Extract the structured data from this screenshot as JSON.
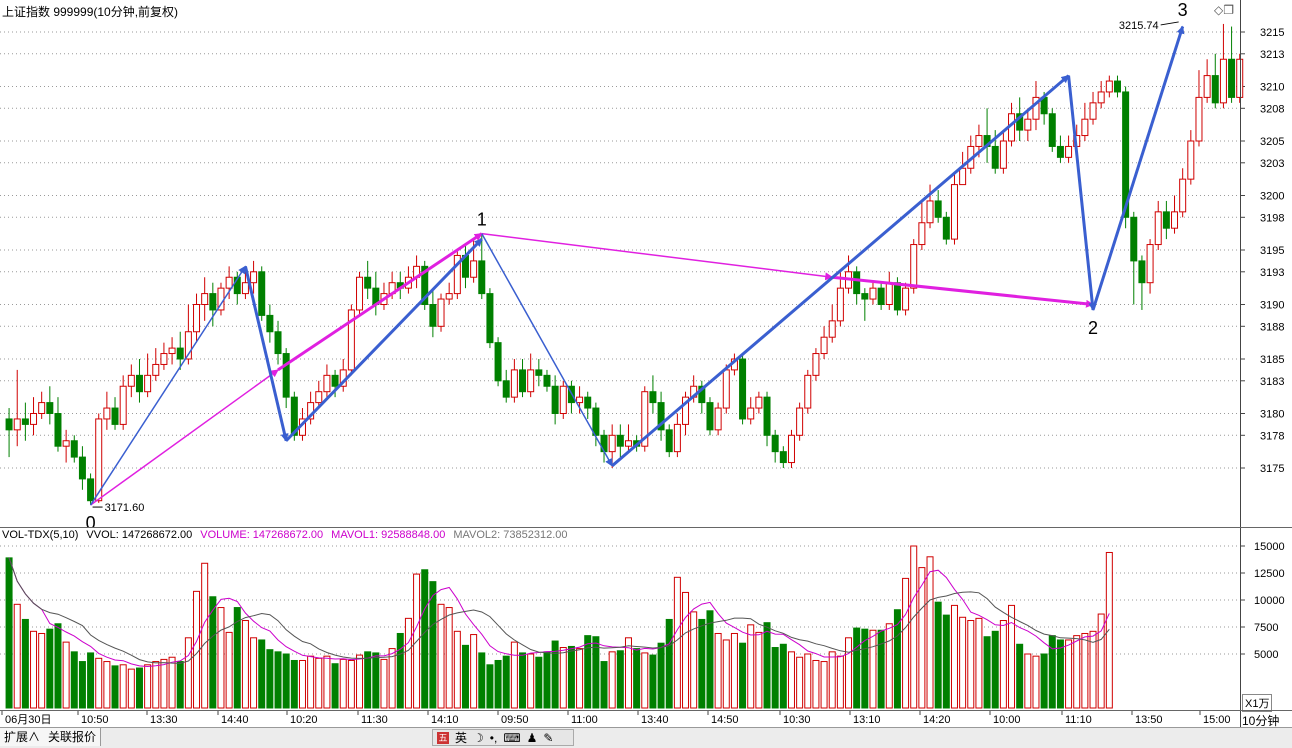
{
  "header": {
    "title": "上证指数 999999(10分钟,前复权)"
  },
  "volume_header": {
    "indicator": "VOL-TDX(5,10)",
    "vvol": "VVOL: 147268672.00",
    "volume": "VOLUME: 147268672.00",
    "mavol1": "MAVOL1: 92588848.00",
    "mavol2": "MAVOL2: 73852312.00"
  },
  "price_axis": [
    "3215",
    "3213",
    "3210",
    "3208",
    "3205",
    "3203",
    "3200",
    "3198",
    "3195",
    "3193",
    "3190",
    "3188",
    "3185",
    "3183",
    "3180",
    "3178",
    "3175"
  ],
  "volume_axis": [
    "15000",
    "12500",
    "10000",
    "7500",
    "5000"
  ],
  "volume_unit": "X1万",
  "time_axis": [
    "06月30日",
    "10:50",
    "13:30",
    "14:40",
    "10:20",
    "11:30",
    "14:10",
    "09:50",
    "11:00",
    "13:40",
    "14:50",
    "10:30",
    "13:10",
    "14:20",
    "10:00",
    "11:10",
    "13:50",
    "15:00"
  ],
  "period_label": "10分钟",
  "annotations": {
    "low_value": "3171.60",
    "high_value": "3215.74",
    "wave_labels": [
      "0",
      "1",
      "2",
      "3"
    ]
  },
  "bottom_tabs": {
    "expand": "扩展∧",
    "quotes": "关联报价"
  },
  "ime": {
    "lang": "英"
  },
  "colors": {
    "up": "#d00000",
    "down": "#008000",
    "blue_arrow": "#3a5fd0",
    "magenta_arrow": "#e020e0",
    "ma1": "#cc00cc",
    "ma2": "#555555"
  },
  "chart_data": {
    "type": "candlestick",
    "ylim": [
      3169.5,
      3216.5
    ],
    "candles": [
      {
        "o": 3179.5,
        "c": 3178.5,
        "h": 3180.5,
        "l": 3176
      },
      {
        "o": 3178.5,
        "c": 3179.5,
        "h": 3184,
        "l": 3177
      },
      {
        "o": 3179.5,
        "c": 3179,
        "h": 3181,
        "l": 3177.5
      },
      {
        "o": 3179,
        "c": 3180,
        "h": 3181.5,
        "l": 3178
      },
      {
        "o": 3180,
        "c": 3181,
        "h": 3182,
        "l": 3179.5
      },
      {
        "o": 3181,
        "c": 3180,
        "h": 3182.5,
        "l": 3179
      },
      {
        "o": 3180,
        "c": 3177,
        "h": 3181.5,
        "l": 3176.5
      },
      {
        "o": 3177,
        "c": 3177.5,
        "h": 3178.5,
        "l": 3175.5
      },
      {
        "o": 3177.5,
        "c": 3176,
        "h": 3178,
        "l": 3175.5
      },
      {
        "o": 3176,
        "c": 3174,
        "h": 3177,
        "l": 3173
      },
      {
        "o": 3174,
        "c": 3172,
        "h": 3174.5,
        "l": 3171.6
      },
      {
        "o": 3172,
        "c": 3179.5,
        "h": 3180,
        "l": 3171.8
      },
      {
        "o": 3179.5,
        "c": 3180.5,
        "h": 3182,
        "l": 3178.5
      },
      {
        "o": 3180.5,
        "c": 3179,
        "h": 3181.5,
        "l": 3178.5
      },
      {
        "o": 3179,
        "c": 3182.5,
        "h": 3183.5,
        "l": 3178.5
      },
      {
        "o": 3182.5,
        "c": 3183.5,
        "h": 3184.5,
        "l": 3181.5
      },
      {
        "o": 3183.5,
        "c": 3182,
        "h": 3185,
        "l": 3181
      },
      {
        "o": 3182,
        "c": 3183.5,
        "h": 3185.5,
        "l": 3181.5
      },
      {
        "o": 3183.5,
        "c": 3184.5,
        "h": 3186,
        "l": 3183
      },
      {
        "o": 3184.5,
        "c": 3185.5,
        "h": 3186.5,
        "l": 3184
      },
      {
        "o": 3185.5,
        "c": 3186,
        "h": 3187,
        "l": 3184.5
      },
      {
        "o": 3186,
        "c": 3185,
        "h": 3187.5,
        "l": 3184
      },
      {
        "o": 3185,
        "c": 3187.5,
        "h": 3190,
        "l": 3184.5
      },
      {
        "o": 3187.5,
        "c": 3190,
        "h": 3191,
        "l": 3186.5
      },
      {
        "o": 3190,
        "c": 3191,
        "h": 3192.5,
        "l": 3188.5
      },
      {
        "o": 3191,
        "c": 3189.5,
        "h": 3192,
        "l": 3188
      },
      {
        "o": 3189.5,
        "c": 3191.5,
        "h": 3192,
        "l": 3189
      },
      {
        "o": 3191.5,
        "c": 3192.5,
        "h": 3193.5,
        "l": 3190.5
      },
      {
        "o": 3192.5,
        "c": 3191,
        "h": 3193,
        "l": 3190
      },
      {
        "o": 3191,
        "c": 3192,
        "h": 3193,
        "l": 3190.5
      },
      {
        "o": 3192,
        "c": 3193,
        "h": 3194,
        "l": 3191
      },
      {
        "o": 3193,
        "c": 3189,
        "h": 3193.5,
        "l": 3188.5
      },
      {
        "o": 3189,
        "c": 3187.5,
        "h": 3190,
        "l": 3186.5
      },
      {
        "o": 3187.5,
        "c": 3185.5,
        "h": 3188.5,
        "l": 3184.5
      },
      {
        "o": 3185.5,
        "c": 3181.5,
        "h": 3186,
        "l": 3180.5
      },
      {
        "o": 3181.5,
        "c": 3178,
        "h": 3182,
        "l": 3177.5
      },
      {
        "o": 3178,
        "c": 3179.5,
        "h": 3180.5,
        "l": 3177.5
      },
      {
        "o": 3179.5,
        "c": 3181,
        "h": 3182,
        "l": 3179
      },
      {
        "o": 3181,
        "c": 3182,
        "h": 3183,
        "l": 3180.5
      },
      {
        "o": 3182,
        "c": 3183.5,
        "h": 3184.5,
        "l": 3181.5
      },
      {
        "o": 3183.5,
        "c": 3182.5,
        "h": 3184,
        "l": 3181.5
      },
      {
        "o": 3182.5,
        "c": 3184,
        "h": 3185,
        "l": 3182
      },
      {
        "o": 3184,
        "c": 3189.5,
        "h": 3190,
        "l": 3183.5
      },
      {
        "o": 3189.5,
        "c": 3192.5,
        "h": 3193,
        "l": 3189
      },
      {
        "o": 3192.5,
        "c": 3191.5,
        "h": 3194,
        "l": 3190.5
      },
      {
        "o": 3191.5,
        "c": 3190,
        "h": 3193,
        "l": 3189
      },
      {
        "o": 3190,
        "c": 3191,
        "h": 3192,
        "l": 3189.5
      },
      {
        "o": 3191,
        "c": 3192,
        "h": 3193,
        "l": 3190.5
      },
      {
        "o": 3192,
        "c": 3191.5,
        "h": 3193,
        "l": 3190.5
      },
      {
        "o": 3191.5,
        "c": 3192.5,
        "h": 3193.5,
        "l": 3191
      },
      {
        "o": 3192.5,
        "c": 3193.5,
        "h": 3194.5,
        "l": 3191.5
      },
      {
        "o": 3193.5,
        "c": 3190,
        "h": 3194,
        "l": 3189.5
      },
      {
        "o": 3190,
        "c": 3188,
        "h": 3191.5,
        "l": 3187
      },
      {
        "o": 3188,
        "c": 3190.5,
        "h": 3191,
        "l": 3187.5
      },
      {
        "o": 3190.5,
        "c": 3191,
        "h": 3192,
        "l": 3190
      },
      {
        "o": 3191,
        "c": 3194.5,
        "h": 3195,
        "l": 3190.5
      },
      {
        "o": 3194.5,
        "c": 3192.5,
        "h": 3195.5,
        "l": 3191.5
      },
      {
        "o": 3192.5,
        "c": 3194,
        "h": 3196,
        "l": 3192
      },
      {
        "o": 3194,
        "c": 3191,
        "h": 3196.5,
        "l": 3190.5
      },
      {
        "o": 3191,
        "c": 3186.5,
        "h": 3191.5,
        "l": 3186
      },
      {
        "o": 3186.5,
        "c": 3183,
        "h": 3187,
        "l": 3182.5
      },
      {
        "o": 3183,
        "c": 3181.5,
        "h": 3184,
        "l": 3181
      },
      {
        "o": 3181.5,
        "c": 3184,
        "h": 3185,
        "l": 3181
      },
      {
        "o": 3184,
        "c": 3182,
        "h": 3185,
        "l": 3181.5
      },
      {
        "o": 3182,
        "c": 3184,
        "h": 3185.5,
        "l": 3181.5
      },
      {
        "o": 3184,
        "c": 3183.5,
        "h": 3185,
        "l": 3182.5
      },
      {
        "o": 3183.5,
        "c": 3182.5,
        "h": 3184,
        "l": 3182
      },
      {
        "o": 3182.5,
        "c": 3180,
        "h": 3183.5,
        "l": 3179
      },
      {
        "o": 3180,
        "c": 3182.5,
        "h": 3183,
        "l": 3179.5
      },
      {
        "o": 3182.5,
        "c": 3181,
        "h": 3183,
        "l": 3180
      },
      {
        "o": 3181,
        "c": 3181.5,
        "h": 3182.5,
        "l": 3180
      },
      {
        "o": 3181.5,
        "c": 3180.5,
        "h": 3182,
        "l": 3179.5
      },
      {
        "o": 3180.5,
        "c": 3178,
        "h": 3181,
        "l": 3177
      },
      {
        "o": 3178,
        "c": 3176.5,
        "h": 3178.5,
        "l": 3175.5
      },
      {
        "o": 3176.5,
        "c": 3178,
        "h": 3179,
        "l": 3175
      },
      {
        "o": 3178,
        "c": 3177,
        "h": 3179,
        "l": 3176
      },
      {
        "o": 3177,
        "c": 3177.5,
        "h": 3179,
        "l": 3176.5
      },
      {
        "o": 3177.5,
        "c": 3177,
        "h": 3178,
        "l": 3176.5
      },
      {
        "o": 3177,
        "c": 3182,
        "h": 3182.5,
        "l": 3176.5
      },
      {
        "o": 3182,
        "c": 3181,
        "h": 3183.5,
        "l": 3180
      },
      {
        "o": 3181,
        "c": 3178.5,
        "h": 3182,
        "l": 3177.5
      },
      {
        "o": 3178.5,
        "c": 3176.5,
        "h": 3179,
        "l": 3176
      },
      {
        "o": 3176.5,
        "c": 3179,
        "h": 3180,
        "l": 3176
      },
      {
        "o": 3179,
        "c": 3181.5,
        "h": 3182,
        "l": 3178
      },
      {
        "o": 3181.5,
        "c": 3182.5,
        "h": 3183.5,
        "l": 3181
      },
      {
        "o": 3182.5,
        "c": 3181,
        "h": 3183,
        "l": 3180
      },
      {
        "o": 3181,
        "c": 3178.5,
        "h": 3181.5,
        "l": 3178
      },
      {
        "o": 3178.5,
        "c": 3180.5,
        "h": 3181,
        "l": 3178
      },
      {
        "o": 3180.5,
        "c": 3184,
        "h": 3184.5,
        "l": 3180
      },
      {
        "o": 3184,
        "c": 3185,
        "h": 3185.5,
        "l": 3183.5
      },
      {
        "o": 3185,
        "c": 3179.5,
        "h": 3185.5,
        "l": 3179
      },
      {
        "o": 3179.5,
        "c": 3180.5,
        "h": 3181.5,
        "l": 3179
      },
      {
        "o": 3180.5,
        "c": 3181.5,
        "h": 3182,
        "l": 3180
      },
      {
        "o": 3181.5,
        "c": 3178,
        "h": 3182,
        "l": 3177
      },
      {
        "o": 3178,
        "c": 3176.5,
        "h": 3178.5,
        "l": 3175.5
      },
      {
        "o": 3176.5,
        "c": 3175.5,
        "h": 3177,
        "l": 3175
      },
      {
        "o": 3175.5,
        "c": 3178,
        "h": 3178.5,
        "l": 3175
      },
      {
        "o": 3178,
        "c": 3180.5,
        "h": 3181,
        "l": 3177.5
      },
      {
        "o": 3180.5,
        "c": 3183.5,
        "h": 3184,
        "l": 3180
      },
      {
        "o": 3183.5,
        "c": 3185.5,
        "h": 3186,
        "l": 3183
      },
      {
        "o": 3185.5,
        "c": 3187,
        "h": 3188,
        "l": 3185
      },
      {
        "o": 3187,
        "c": 3188.5,
        "h": 3190,
        "l": 3186.5
      },
      {
        "o": 3188.5,
        "c": 3191.5,
        "h": 3193,
        "l": 3188
      },
      {
        "o": 3191.5,
        "c": 3193,
        "h": 3194.5,
        "l": 3191
      },
      {
        "o": 3193,
        "c": 3191,
        "h": 3193.5,
        "l": 3190
      },
      {
        "o": 3191,
        "c": 3190.5,
        "h": 3191.5,
        "l": 3188.5
      },
      {
        "o": 3190.5,
        "c": 3191.5,
        "h": 3192,
        "l": 3190
      },
      {
        "o": 3191.5,
        "c": 3190,
        "h": 3192,
        "l": 3189.5
      },
      {
        "o": 3190,
        "c": 3192,
        "h": 3193,
        "l": 3189.5
      },
      {
        "o": 3192,
        "c": 3189.5,
        "h": 3192.5,
        "l": 3189
      },
      {
        "o": 3189.5,
        "c": 3191.5,
        "h": 3192,
        "l": 3189
      },
      {
        "o": 3191.5,
        "c": 3195.5,
        "h": 3196,
        "l": 3191
      },
      {
        "o": 3195.5,
        "c": 3197.5,
        "h": 3199.5,
        "l": 3195
      },
      {
        "o": 3197.5,
        "c": 3199.5,
        "h": 3201,
        "l": 3197
      },
      {
        "o": 3199.5,
        "c": 3198,
        "h": 3200.5,
        "l": 3197.5
      },
      {
        "o": 3198,
        "c": 3196,
        "h": 3198.5,
        "l": 3195.5
      },
      {
        "o": 3196,
        "c": 3201,
        "h": 3202,
        "l": 3195.5
      },
      {
        "o": 3201,
        "c": 3202.5,
        "h": 3204,
        "l": 3201
      },
      {
        "o": 3202.5,
        "c": 3204.5,
        "h": 3205.5,
        "l": 3202
      },
      {
        "o": 3204.5,
        "c": 3205.5,
        "h": 3206.5,
        "l": 3203.5
      },
      {
        "o": 3205.5,
        "c": 3204.5,
        "h": 3208,
        "l": 3203
      },
      {
        "o": 3204.5,
        "c": 3202.5,
        "h": 3206,
        "l": 3202
      },
      {
        "o": 3202.5,
        "c": 3205,
        "h": 3206,
        "l": 3202
      },
      {
        "o": 3205,
        "c": 3207.5,
        "h": 3208.5,
        "l": 3204.5
      },
      {
        "o": 3207.5,
        "c": 3206,
        "h": 3209,
        "l": 3205
      },
      {
        "o": 3206,
        "c": 3207,
        "h": 3208,
        "l": 3205
      },
      {
        "o": 3207,
        "c": 3209,
        "h": 3210.5,
        "l": 3206
      },
      {
        "o": 3209,
        "c": 3207.5,
        "h": 3209.5,
        "l": 3206.5
      },
      {
        "o": 3207.5,
        "c": 3204.5,
        "h": 3208,
        "l": 3204
      },
      {
        "o": 3204.5,
        "c": 3203.5,
        "h": 3205.5,
        "l": 3203
      },
      {
        "o": 3203.5,
        "c": 3204.5,
        "h": 3205.5,
        "l": 3203
      },
      {
        "o": 3204.5,
        "c": 3205.5,
        "h": 3206.5,
        "l": 3203.5
      },
      {
        "o": 3205.5,
        "c": 3207,
        "h": 3208.5,
        "l": 3205
      },
      {
        "o": 3207,
        "c": 3208.5,
        "h": 3209.5,
        "l": 3206.5
      },
      {
        "o": 3208.5,
        "c": 3209.5,
        "h": 3210.5,
        "l": 3208
      },
      {
        "o": 3209.5,
        "c": 3210.5,
        "h": 3211,
        "l": 3209
      },
      {
        "o": 3210.5,
        "c": 3209.5,
        "h": 3211,
        "l": 3209
      },
      {
        "o": 3209.5,
        "c": 3198,
        "h": 3210,
        "l": 3197
      },
      {
        "o": 3198,
        "c": 3194,
        "h": 3198.5,
        "l": 3190
      },
      {
        "o": 3194,
        "c": 3192,
        "h": 3194.5,
        "l": 3189.5
      },
      {
        "o": 3192,
        "c": 3195.5,
        "h": 3196,
        "l": 3191
      },
      {
        "o": 3195.5,
        "c": 3198.5,
        "h": 3199.5,
        "l": 3195
      },
      {
        "o": 3198.5,
        "c": 3197,
        "h": 3199.5,
        "l": 3196
      },
      {
        "o": 3197,
        "c": 3198.5,
        "h": 3200,
        "l": 3196.5
      },
      {
        "o": 3198.5,
        "c": 3201.5,
        "h": 3202.5,
        "l": 3198
      },
      {
        "o": 3201.5,
        "c": 3205,
        "h": 3206,
        "l": 3201
      },
      {
        "o": 3205,
        "c": 3209,
        "h": 3211.5,
        "l": 3204.5
      },
      {
        "o": 3209,
        "c": 3211,
        "h": 3212.5,
        "l": 3208.5
      },
      {
        "o": 3211,
        "c": 3208.5,
        "h": 3213,
        "l": 3208
      },
      {
        "o": 3208.5,
        "c": 3212.5,
        "h": 3215.74,
        "l": 3208
      },
      {
        "o": 3212.5,
        "c": 3209,
        "h": 3215.5,
        "l": 3208.5
      },
      {
        "o": 3209,
        "c": 3212.5,
        "h": 3213,
        "l": 3208.5
      }
    ],
    "volumes": [
      13.9,
      9.6,
      8.2,
      7.1,
      6.9,
      7.3,
      7.8,
      6.1,
      5.2,
      4.3,
      5.1,
      4.6,
      4.3,
      3.9,
      4.0,
      3.6,
      3.7,
      4.0,
      4.3,
      4.5,
      4.7,
      4.3,
      6.5,
      10.8,
      13.4,
      10.3,
      9.3,
      7.0,
      9.3,
      8.1,
      6.5,
      6.3,
      5.4,
      5.2,
      5.0,
      4.4,
      4.4,
      4.8,
      4.6,
      4.8,
      4.1,
      4.5,
      4.4,
      4.9,
      5.2,
      5.1,
      4.5,
      5.5,
      6.9,
      8.3,
      12.4,
      12.8,
      11.7,
      9.6,
      9.3,
      7.1,
      5.8,
      6.8,
      5.1,
      4.0,
      4.4,
      4.8,
      6.1,
      5.1,
      5.0,
      4.7,
      5.2,
      6.2,
      5.6,
      5.7,
      5.5,
      6.7,
      6.6,
      4.3,
      5.2,
      5.3,
      6.5,
      5.5,
      5.1,
      4.9,
      6.0,
      8.2,
      12.1,
      10.7,
      8.9,
      8.2,
      9.0,
      6.9,
      6.3,
      6.9,
      6.0,
      7.7,
      7.0,
      7.9,
      5.6,
      5.9,
      5.2,
      4.7,
      5.0,
      4.4,
      4.3,
      5.2,
      4.8,
      6.5,
      7.4,
      7.3,
      7.2,
      7.2,
      7.8,
      9.1,
      12.0,
      15.0,
      13.0,
      14.0,
      9.8,
      8.6,
      9.5,
      8.4,
      8.1,
      8.3,
      6.6,
      7.1,
      8.1,
      9.5,
      5.9,
      5.0,
      4.8,
      5.0,
      6.7,
      6.3,
      6.3,
      6.7,
      6.9,
      7.1,
      8.7,
      14.4
    ]
  }
}
